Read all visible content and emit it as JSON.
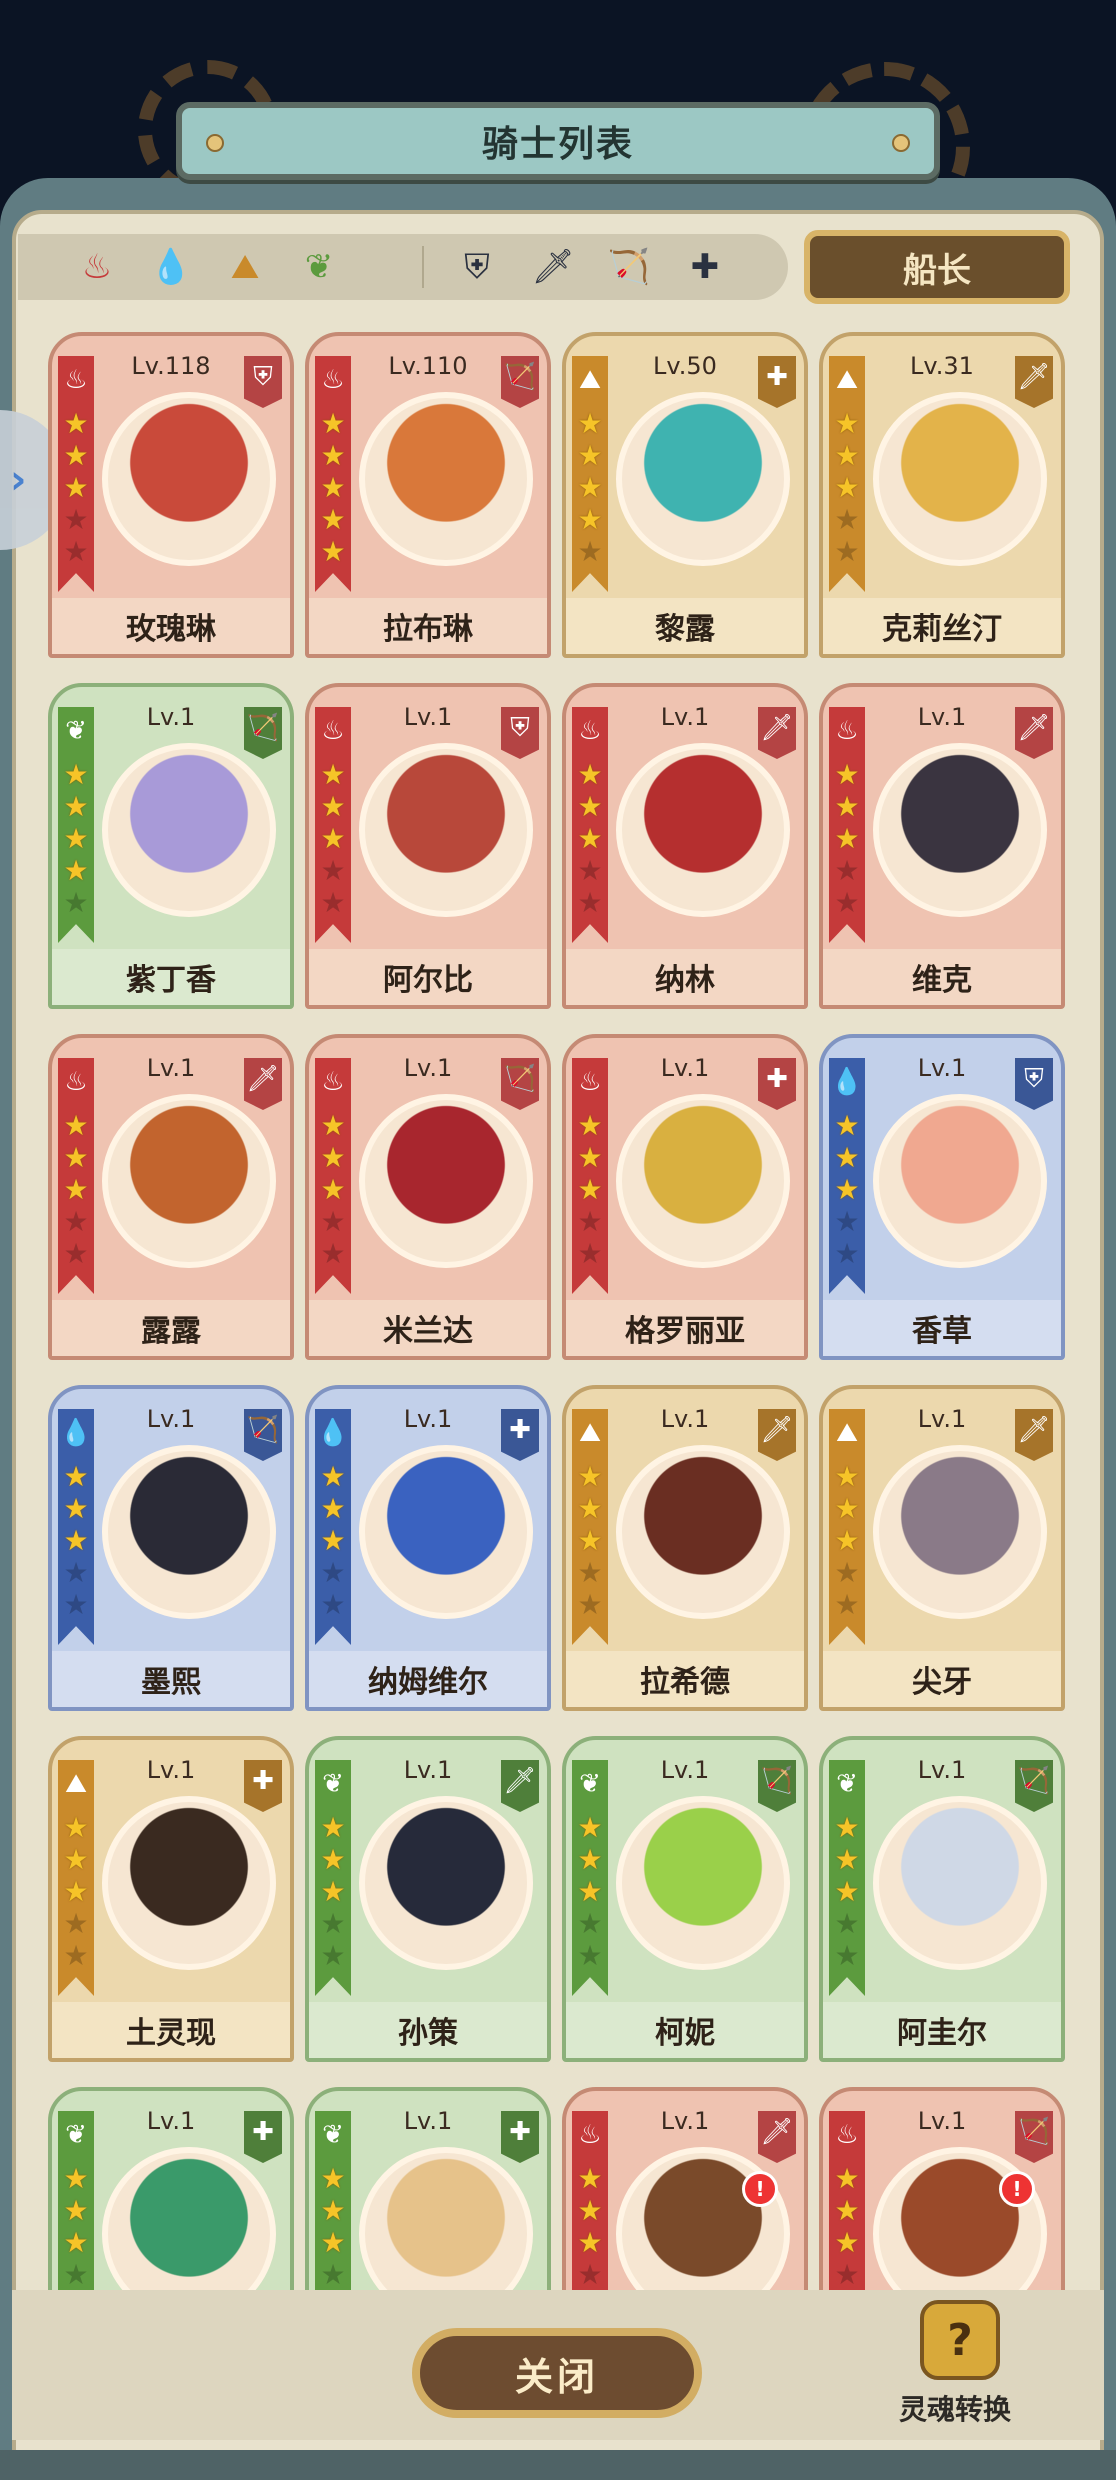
{
  "title": "骑士列表",
  "filters": {
    "elements": [
      {
        "icon": "fire-element-icon",
        "glyph": "♨",
        "color": "#c53a3a"
      },
      {
        "icon": "water-element-icon",
        "glyph": "💧",
        "color": "#3b68c0"
      },
      {
        "icon": "earth-element-icon",
        "glyph": "⛰",
        "color": "#c98a2b"
      },
      {
        "icon": "wood-element-icon",
        "glyph": "❦",
        "color": "#5c9b3e"
      }
    ],
    "classes": [
      {
        "icon": "shield-class-icon",
        "glyph": "⛨"
      },
      {
        "icon": "sword-class-icon",
        "glyph": "🗡"
      },
      {
        "icon": "bow-class-icon",
        "glyph": "🏹"
      },
      {
        "icon": "support-class-icon",
        "glyph": "✚"
      }
    ]
  },
  "captain_label": "船长",
  "knights": [
    {
      "name": "玫瑰琳",
      "level": "Lv.118",
      "element": "fire",
      "class": "shield",
      "stars": 3,
      "portrait": "#c94a3a"
    },
    {
      "name": "拉布琳",
      "level": "Lv.110",
      "element": "fire",
      "class": "bow",
      "stars": 5,
      "portrait": "#d9783a"
    },
    {
      "name": "黎露",
      "level": "Lv.50",
      "element": "earth",
      "class": "support",
      "stars": 4,
      "portrait": "#3fb3b0"
    },
    {
      "name": "克莉丝汀",
      "level": "Lv.31",
      "element": "earth",
      "class": "sword",
      "stars": 3,
      "portrait": "#e3b34a"
    },
    {
      "name": "紫丁香",
      "level": "Lv.1",
      "element": "wood",
      "class": "bow",
      "stars": 4,
      "portrait": "#a89ad8"
    },
    {
      "name": "阿尔比",
      "level": "Lv.1",
      "element": "fire",
      "class": "shield",
      "stars": 3,
      "portrait": "#b8483a"
    },
    {
      "name": "纳林",
      "level": "Lv.1",
      "element": "fire",
      "class": "sword",
      "stars": 3,
      "portrait": "#b52f2f"
    },
    {
      "name": "维克",
      "level": "Lv.1",
      "element": "fire",
      "class": "sword",
      "stars": 3,
      "portrait": "#3a3440"
    },
    {
      "name": "露露",
      "level": "Lv.1",
      "element": "fire",
      "class": "sword",
      "stars": 3,
      "portrait": "#c2642e"
    },
    {
      "name": "米兰达",
      "level": "Lv.1",
      "element": "fire",
      "class": "bow",
      "stars": 3,
      "portrait": "#a8262e"
    },
    {
      "name": "格罗丽亚",
      "level": "Lv.1",
      "element": "fire",
      "class": "support",
      "stars": 3,
      "portrait": "#d9b040"
    },
    {
      "name": "香草",
      "level": "Lv.1",
      "element": "water",
      "class": "shield",
      "stars": 3,
      "portrait": "#f0a890"
    },
    {
      "name": "墨熙",
      "level": "Lv.1",
      "element": "water",
      "class": "bow",
      "stars": 3,
      "portrait": "#2a2a36"
    },
    {
      "name": "纳姆维尔",
      "level": "Lv.1",
      "element": "water",
      "class": "support",
      "stars": 3,
      "portrait": "#3a62c0"
    },
    {
      "name": "拉希德",
      "level": "Lv.1",
      "element": "earth",
      "class": "sword",
      "stars": 3,
      "portrait": "#6a2e22"
    },
    {
      "name": "尖牙",
      "level": "Lv.1",
      "element": "earth",
      "class": "sword",
      "stars": 3,
      "portrait": "#8a7a88"
    },
    {
      "name": "土灵现",
      "level": "Lv.1",
      "element": "earth",
      "class": "support",
      "stars": 3,
      "portrait": "#3a2a20"
    },
    {
      "name": "孙策",
      "level": "Lv.1",
      "element": "wood",
      "class": "sword",
      "stars": 3,
      "portrait": "#262a3a"
    },
    {
      "name": "柯妮",
      "level": "Lv.1",
      "element": "wood",
      "class": "bow",
      "stars": 3,
      "portrait": "#9ad04a"
    },
    {
      "name": "阿圭尔",
      "level": "Lv.1",
      "element": "wood",
      "class": "bow",
      "stars": 3,
      "portrait": "#cfd8e6"
    },
    {
      "name": "",
      "level": "Lv.1",
      "element": "wood",
      "class": "support",
      "stars": 3,
      "portrait": "#3a9a6a"
    },
    {
      "name": "",
      "level": "Lv.1",
      "element": "wood",
      "class": "support",
      "stars": 3,
      "portrait": "#e6c28a"
    },
    {
      "name": "",
      "level": "Lv.1",
      "element": "fire",
      "class": "sword",
      "stars": 3,
      "portrait": "#7a4a2a",
      "alert": true
    },
    {
      "name": "",
      "level": "Lv.1",
      "element": "fire",
      "class": "bow",
      "stars": 3,
      "portrait": "#9a4a2a",
      "alert": true
    }
  ],
  "close_label": "关闭",
  "soul_convert_label": "灵魂转换",
  "alert_badge": "!",
  "side_tab_glyph": "›"
}
